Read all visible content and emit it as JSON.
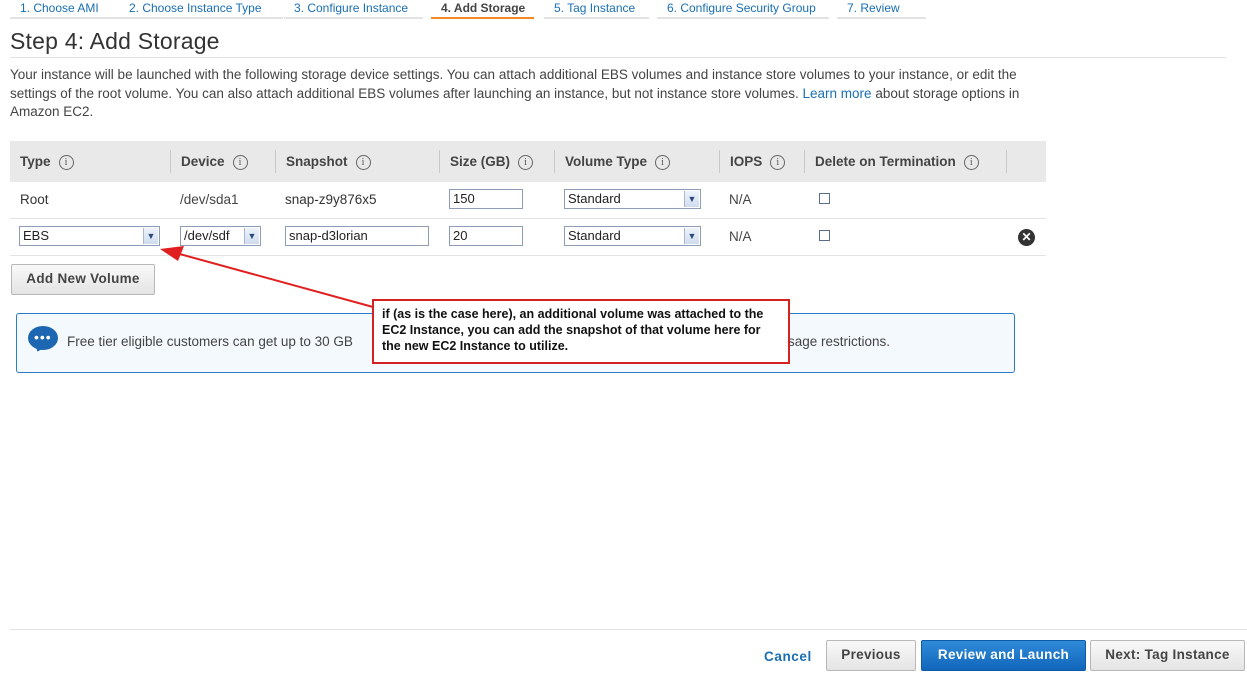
{
  "wizard": {
    "steps": [
      {
        "label": "1. Choose AMI"
      },
      {
        "label": "2. Choose Instance Type"
      },
      {
        "label": "3. Configure Instance"
      },
      {
        "label": "4. Add Storage"
      },
      {
        "label": "5. Tag Instance"
      },
      {
        "label": "6. Configure Security Group"
      },
      {
        "label": "7. Review"
      }
    ],
    "active_step": 4
  },
  "page": {
    "title": "Step 4: Add Storage",
    "intro_part1": "Your instance will be launched with the following storage device settings. You can attach additional EBS volumes and instance store volumes to your instance, or edit the settings of the root volume. You can also attach additional EBS volumes after launching an instance, but not instance store volumes.",
    "learn_more": "Learn more",
    "intro_part2": "about storage options in Amazon EC2."
  },
  "table": {
    "headers": {
      "type": "Type",
      "device": "Device",
      "snapshot": "Snapshot",
      "size": "Size (GB)",
      "volume_type": "Volume Type",
      "iops": "IOPS",
      "delete": "Delete on Termination"
    },
    "info_glyph": "i",
    "rows": [
      {
        "type": "Root",
        "device": "/dev/sda1",
        "snapshot": "snap-z9y876x5",
        "size": "150",
        "volume_type": "Standard",
        "iops": "N/A",
        "delete_on_termination": false
      },
      {
        "type": "EBS",
        "device": "/dev/sdf",
        "snapshot": "snap-d3lorian",
        "size": "20",
        "volume_type": "Standard",
        "iops": "N/A",
        "delete_on_termination": false
      }
    ]
  },
  "buttons": {
    "add_volume": "Add New Volume",
    "cancel": "Cancel",
    "previous": "Previous",
    "review_launch": "Review and Launch",
    "next": "Next: Tag Instance"
  },
  "info_box": {
    "text_left": "Free tier eligible customers can get up to 30 GB",
    "text_right": "sage restrictions."
  },
  "annotation": {
    "text": "if (as is the case here), an additional volume was attached to the EC2 Instance, you can add the snapshot of that volume here for the new EC2 Instance to utilize.",
    "color": "#d42222"
  },
  "colors": {
    "link": "#1a6fb3",
    "primary_button": "#1a73c8",
    "active_step_underline": "#f08a24"
  }
}
